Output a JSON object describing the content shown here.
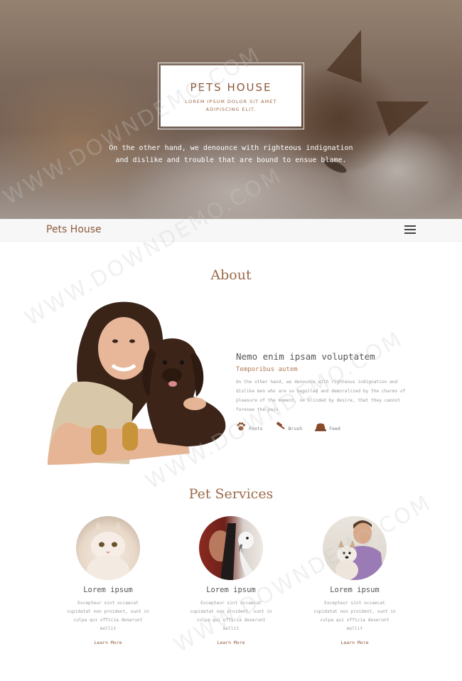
{
  "hero": {
    "site_title": "PETS HOUSE",
    "subtitle": "LOREM IPSUM DOLOR SIT AMET ADIPISCING ELIT.",
    "text_line1": "On the other hand, we denounce with righteous indignation",
    "text_line2": "and dislike and trouble that are bound to ensue blame."
  },
  "nav": {
    "brand": "Pets House",
    "menu_icon": "hamburger-menu-icon"
  },
  "about": {
    "title": "About",
    "heading": "Nemo enim ipsam voluptatem",
    "subheading": "Temporibus autem",
    "body": "On the other hand, we denounce with righteous indignation and dislike men who are so beguiled and demoralized by the charms of pleasure of the moment, so blinded by desire, that they cannot foresee the pain",
    "icons": [
      {
        "icon": "paw-icon",
        "label": "Foots"
      },
      {
        "icon": "brush-icon",
        "label": "Brush"
      },
      {
        "icon": "food-bowl-icon",
        "label": "Feed"
      }
    ]
  },
  "services": {
    "title": "Pet Services",
    "items": [
      {
        "name": "Lorem ipsum",
        "desc": "Excepteur sint occaecat cupidatat non proident, sunt in culpa qui officia deserunt mollit",
        "link": "Learn More"
      },
      {
        "name": "Lorem ipsum",
        "desc": "Excepteur sint occaecat cupidatat non proident, sunt in culpa qui officia deserunt mollit",
        "link": "Learn More"
      },
      {
        "name": "Lorem ipsum",
        "desc": "Excepteur sint occaecat cupidatat non proident, sunt in culpa qui officia deserunt mollit",
        "link": "Learn More"
      }
    ]
  },
  "watermark": {
    "text": "WWW.DOWNDEMO.COM"
  },
  "colors": {
    "accent": "#8b5a3c",
    "heading": "#9b6a4a",
    "nav_bg": "#f7f7f7"
  }
}
